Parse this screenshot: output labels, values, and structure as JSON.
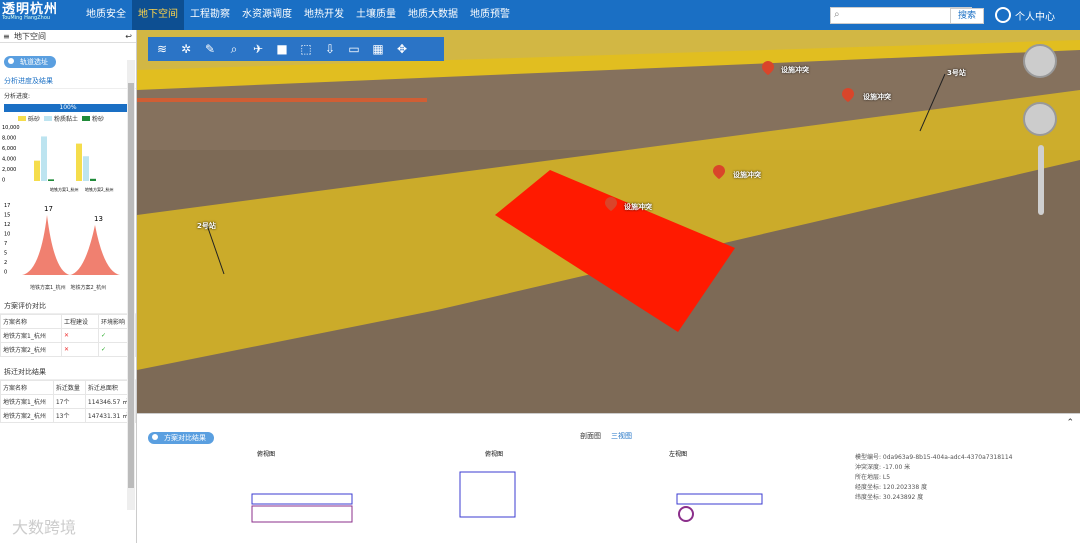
{
  "app": {
    "logo_cn": "透明杭州",
    "logo_en": "TouMing HangZhou"
  },
  "nav": [
    "地质安全",
    "地下空间",
    "工程勘察",
    "水资源调度",
    "地热开发",
    "土壤质量",
    "地质大数据",
    "地质预警"
  ],
  "search": {
    "placeholder": "",
    "button": "搜索"
  },
  "user": {
    "label": "个人中心"
  },
  "sidebar": {
    "title": "地下空间",
    "pill": "轨道选址",
    "analysis_title": "分析进度及结果",
    "progress_label": "分析进度:",
    "progress_value": "100%",
    "legend": [
      "砾砂",
      "粉质黏土",
      "粉砂"
    ],
    "bar_chart": {
      "categories": [
        "地铁方案1_杭州",
        "地铁方案2_杭州"
      ],
      "series": [
        {
          "name": "砾砂",
          "values": [
            3700,
            6800
          ]
        },
        {
          "name": "粉质黏土",
          "values": [
            8100,
            4500
          ]
        },
        {
          "name": "粉砂",
          "values": [
            300,
            400
          ]
        }
      ],
      "ylim": [
        0,
        10000
      ],
      "yticks": [
        "10,000",
        "8,000",
        "6,000",
        "4,000",
        "2,000",
        "0"
      ]
    },
    "peak_chart": {
      "categories": [
        "地铁方案1_杭州",
        "地铁方案2_杭州"
      ],
      "values": [
        17,
        13
      ],
      "yticks": [
        "17",
        "15",
        "12",
        "10",
        "7",
        "5",
        "2",
        "0"
      ]
    },
    "eval_title": "方案评价对比",
    "eval_headers": [
      "方案名称",
      "工程建设",
      "环境影响"
    ],
    "eval_rows": [
      [
        "地铁方案1_杭州",
        "✕",
        "✓"
      ],
      [
        "地铁方案2_杭州",
        "✕",
        "✓"
      ]
    ],
    "demo_title": "拆迁对比结果",
    "demo_headers": [
      "方案名称",
      "拆迁数量",
      "拆迁总面积"
    ],
    "demo_rows": [
      [
        "地铁方案1_杭州",
        "17个",
        "114346.57 ㎡"
      ],
      [
        "地铁方案2_杭州",
        "13个",
        "147431.31 ㎡"
      ]
    ]
  },
  "map": {
    "labels": [
      {
        "text": "设施冲突"
      },
      {
        "text": "设施冲突"
      },
      {
        "text": "设施冲突"
      },
      {
        "text": "设施冲突"
      }
    ],
    "station_labels": [
      "2号站",
      "3号站"
    ]
  },
  "toolbar": [
    "layers-icon",
    "fan-icon",
    "brush-icon",
    "search-icon",
    "plane-icon",
    "square-icon",
    "cube-icon",
    "download-icon",
    "screen-icon",
    "map-icon",
    "drone-icon"
  ],
  "bottom": {
    "pill": "方案对比结果",
    "tabs": [
      "剖面图",
      "三视图"
    ],
    "info": [
      "模型编号: 0da963a9-8b15-404a-adc4-4370a7318114",
      "沖突深度: -17.00 米",
      "所在地层: L5",
      "经度坐标: 120.202338 度",
      "纬度坐标: 30.243892 度"
    ],
    "views": [
      "俯视图",
      "俯视图",
      "左视图"
    ]
  },
  "watermark": "大数跨境",
  "colors": {
    "nav": "#1a6fc4",
    "yellow": "#e6c21c",
    "red": "#ff1a00",
    "brown": "#7d6a56"
  }
}
